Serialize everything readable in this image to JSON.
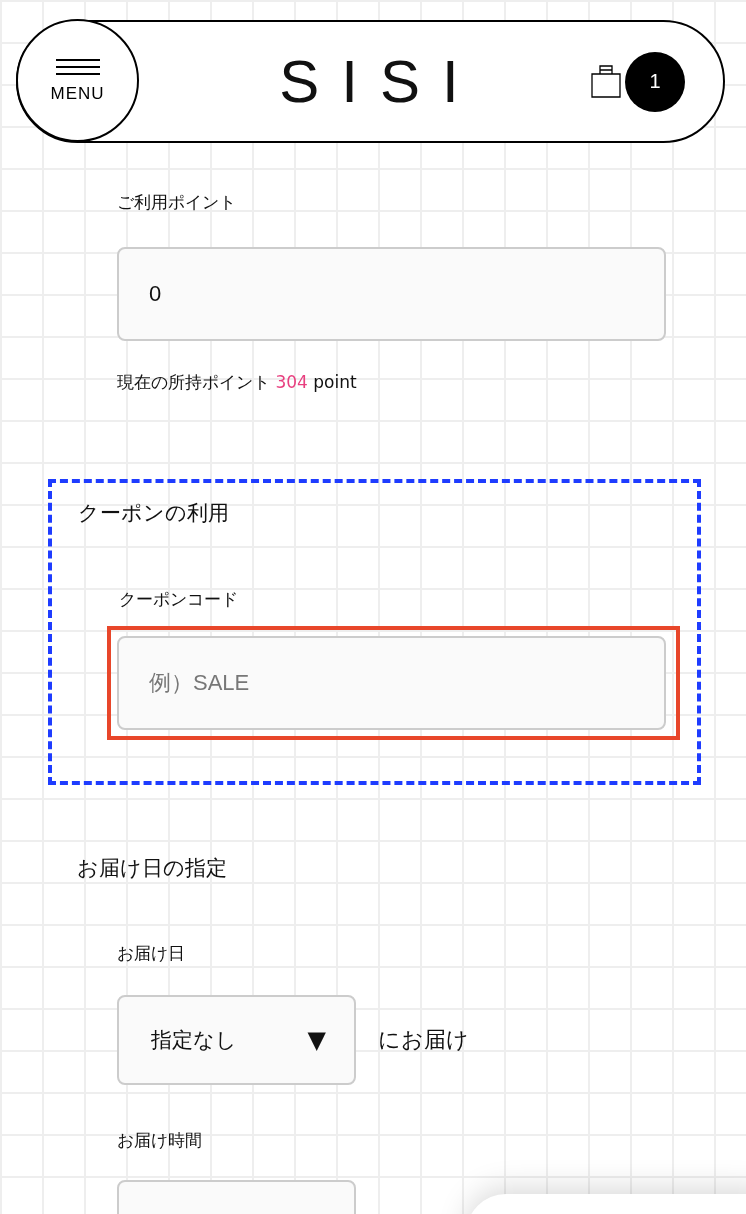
{
  "header": {
    "menu_label": "MENU",
    "logo": "SISI",
    "cart_count": "1"
  },
  "points": {
    "label": "ご利用ポイント",
    "value": "0",
    "balance_prefix": "現在の所持ポイント",
    "balance_value": "304",
    "balance_unit": "point"
  },
  "coupon": {
    "title": "クーポンの利用",
    "label": "クーポンコード",
    "placeholder": "例）SALE"
  },
  "delivery": {
    "title": "お届け日の指定",
    "date_label": "お届け日",
    "date_value": "指定なし",
    "date_arrow": "▼",
    "date_suffix": "にお届け",
    "time_label": "お届け時間"
  }
}
